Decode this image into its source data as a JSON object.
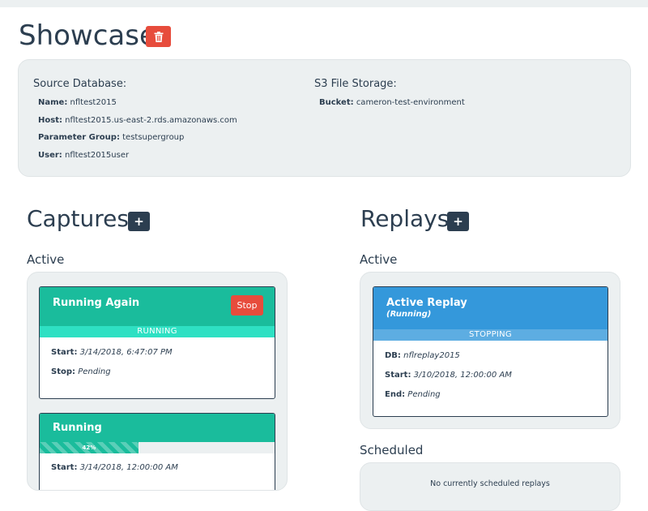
{
  "header": {
    "title": "Showcase"
  },
  "source_database": {
    "heading": "Source Database:",
    "fields": [
      {
        "label": "Name:",
        "value": "nfltest2015"
      },
      {
        "label": "Host:",
        "value": "nfltest2015.us-east-2.rds.amazonaws.com"
      },
      {
        "label": "Parameter Group:",
        "value": "testsupergroup"
      },
      {
        "label": "User:",
        "value": "nfltest2015user"
      }
    ]
  },
  "file_storage": {
    "heading": "S3 File Storage:",
    "fields": [
      {
        "label": "Bucket:",
        "value": "cameron-test-environment"
      }
    ]
  },
  "captures": {
    "title": "Captures",
    "add_label": "+",
    "active_label": "Active",
    "cards": [
      {
        "title": "Running Again",
        "stop_label": "Stop",
        "status": "RUNNING",
        "lines": [
          {
            "label": "Start:",
            "value": "3/14/2018, 6:47:07 PM"
          },
          {
            "label": "Stop:",
            "value": "Pending"
          }
        ]
      },
      {
        "title": "Running",
        "progress": 42,
        "progress_label": "42%",
        "lines": [
          {
            "label": "Start:",
            "value": "3/14/2018, 12:00:00 AM"
          }
        ]
      }
    ]
  },
  "replays": {
    "title": "Replays",
    "add_label": "+",
    "active_label": "Active",
    "scheduled_label": "Scheduled",
    "cards": [
      {
        "title": "Active Replay",
        "subtitle": "(Running)",
        "status": "STOPPING",
        "lines": [
          {
            "label": "DB:",
            "value": "nflreplay2015"
          },
          {
            "label": "Start:",
            "value": "3/10/2018, 12:00:00 AM"
          },
          {
            "label": "End:",
            "value": "Pending"
          }
        ]
      }
    ],
    "scheduled_empty": "No currently scheduled replays"
  },
  "colors": {
    "brand_dark": "#2c3e50",
    "danger": "#e74c3c",
    "success": "#1abc9c",
    "success_light": "#2ee0c3",
    "info": "#3498db",
    "info_light": "#5dade2",
    "panel_bg": "#ecf0f1"
  },
  "icons": {
    "delete": "trash-icon",
    "add": "plus-icon"
  }
}
